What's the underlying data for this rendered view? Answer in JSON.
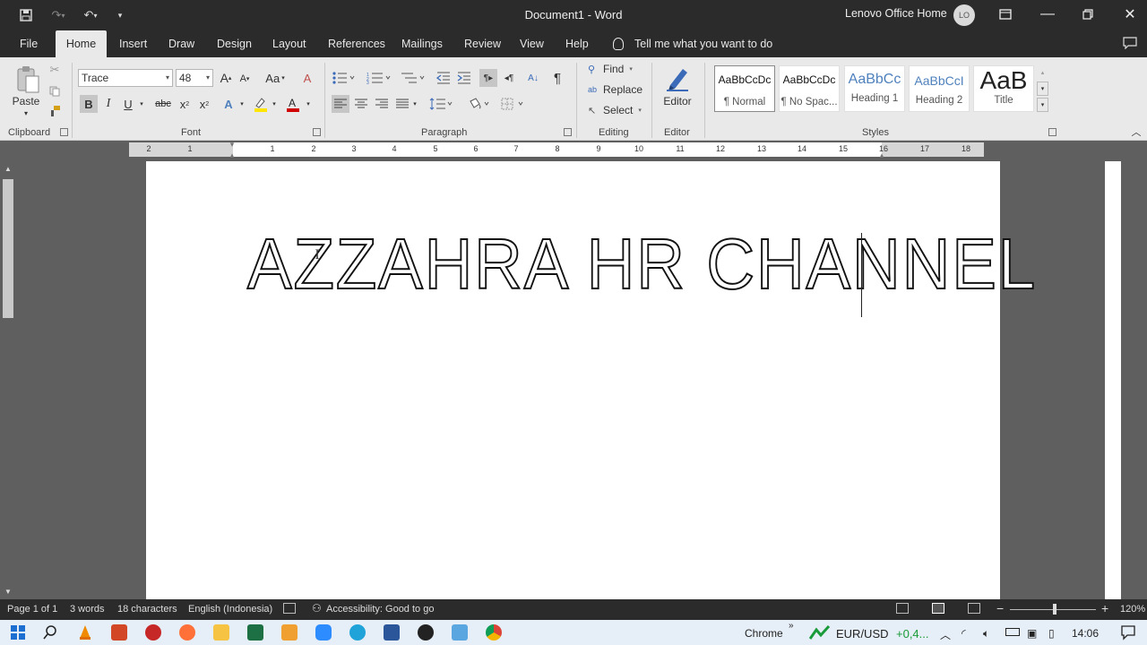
{
  "title_bar": {
    "document_title": "Document1  -  Word",
    "account_name": "Lenovo Office Home",
    "avatar_initials": "LO",
    "quick_access": [
      "save-icon",
      "redo-icon",
      "undo-icon",
      "customize-icon"
    ]
  },
  "ribbon_tabs": [
    "File",
    "Home",
    "Insert",
    "Draw",
    "Design",
    "Layout",
    "References",
    "Mailings",
    "Review",
    "View",
    "Help"
  ],
  "active_tab": "Home",
  "tell_me": "Tell me what you want to do",
  "clipboard": {
    "paste_label": "Paste",
    "group_label": "Clipboard"
  },
  "font": {
    "name": "Trace",
    "size": "48",
    "group_label": "Font",
    "case_label": "Aa"
  },
  "paragraph": {
    "group_label": "Paragraph"
  },
  "editing": {
    "find": "Find",
    "replace": "Replace",
    "select": "Select",
    "group_label": "Editing"
  },
  "editor": {
    "label": "Editor",
    "group_label": "Editor"
  },
  "styles": {
    "group_label": "Styles",
    "items": [
      {
        "sample": "AaBbCcDc",
        "name": "¶ Normal"
      },
      {
        "sample": "AaBbCcDc",
        "name": "¶ No Spac..."
      },
      {
        "sample": "AaBbCc",
        "name": "Heading 1"
      },
      {
        "sample": "AaBbCcI",
        "name": "Heading 2"
      },
      {
        "sample": "AaB",
        "name": "Title"
      }
    ]
  },
  "ruler_numbers": [
    "2",
    "1",
    "1",
    "2",
    "3",
    "4",
    "5",
    "6",
    "7",
    "8",
    "9",
    "10",
    "11",
    "12",
    "13",
    "14",
    "15",
    "16",
    "17",
    "18"
  ],
  "document": {
    "text": "AZZAHRA HR CHANNEL"
  },
  "status_bar": {
    "page": "Page 1 of 1",
    "words": "3 words",
    "characters": "18 characters",
    "language": "English (Indonesia)",
    "accessibility": "Accessibility: Good to go",
    "zoom": "120%"
  },
  "taskbar": {
    "chrome_label": "Chrome",
    "ticker": "EUR/USD",
    "ticker_value": "+0,4...",
    "time": "14:06"
  },
  "colors": {
    "accent": "#2b579a",
    "titlebar": "#2b2b2b",
    "ribbon": "#e9e9e9"
  }
}
